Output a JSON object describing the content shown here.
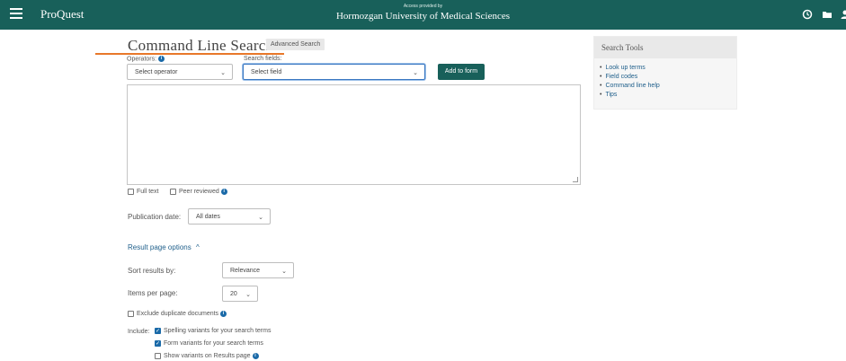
{
  "header": {
    "brand": "ProQuest",
    "access_note": "Access provided by",
    "institution": "Hormozgan University of Medical Sciences"
  },
  "page": {
    "title": "Command Line Search",
    "advanced_link": "Advanced Search"
  },
  "operators": {
    "label": "Operators:",
    "value": "Select operator"
  },
  "fields": {
    "label": "Search fields:",
    "value": "Select field"
  },
  "add_button": "Add to form",
  "limits": {
    "full_text": "Full text",
    "peer_reviewed": "Peer reviewed"
  },
  "pub_date": {
    "label": "Publication date:",
    "value": "All dates"
  },
  "result_options": {
    "toggle": "Result page options",
    "toggle_icon": "^",
    "sort_label": "Sort results by:",
    "sort_value": "Relevance",
    "items_label": "Items per page:",
    "items_value": "20",
    "exclude_dupes": "Exclude duplicate documents",
    "include_label": "Include:",
    "spelling": "Spelling variants for your search terms",
    "form_variants": "Form variants for your search terms",
    "show_variants": "Show variants on Results page"
  },
  "sidebar": {
    "title": "Search Tools",
    "links": [
      "Look up terms",
      "Field codes",
      "Command line help",
      "Tips"
    ]
  },
  "colors": {
    "header_bg": "#18605a",
    "accent_orange": "#e8782a",
    "link_blue": "#1f5f8b",
    "check_blue": "#1a6aa8"
  }
}
